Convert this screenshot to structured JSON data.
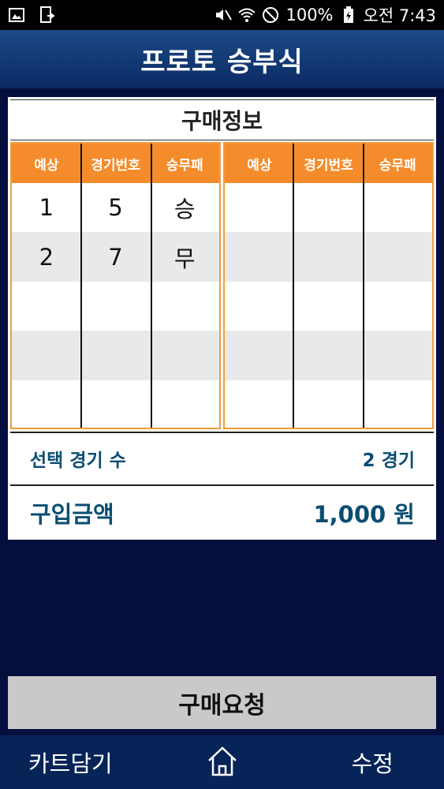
{
  "status_bar": {
    "battery": "100%",
    "time": "오전 7:43",
    "icons": [
      "image-icon",
      "screen-cast-icon",
      "mute-icon",
      "wifi-icon",
      "do-not-disturb-icon",
      "battery-charging-icon"
    ]
  },
  "header": {
    "title": "프로토 승부식"
  },
  "purchase_info": {
    "title": "구매정보",
    "columns": [
      "예상",
      "경기번호",
      "승무패"
    ],
    "left_table": [
      [
        "1",
        "5",
        "승"
      ],
      [
        "2",
        "7",
        "무"
      ],
      [
        "",
        "",
        ""
      ],
      [
        "",
        "",
        ""
      ],
      [
        "",
        "",
        ""
      ]
    ],
    "right_table": [
      [
        "",
        "",
        ""
      ],
      [
        "",
        "",
        ""
      ],
      [
        "",
        "",
        ""
      ],
      [
        "",
        "",
        ""
      ],
      [
        "",
        "",
        ""
      ]
    ],
    "selected_games_label": "선택 경기 수",
    "selected_games_value": "2 경기",
    "amount_label": "구입금액",
    "amount_value": "1,000 원"
  },
  "actions": {
    "purchase_request": "구매요청"
  },
  "bottom_nav": {
    "cart": "카트담기",
    "home_icon": "home-icon",
    "edit": "수정"
  },
  "colors": {
    "header_bg": "#1d4a88",
    "accent_orange": "#f58c2b",
    "summary_text": "#0a4d72",
    "background": "#040f3e"
  }
}
